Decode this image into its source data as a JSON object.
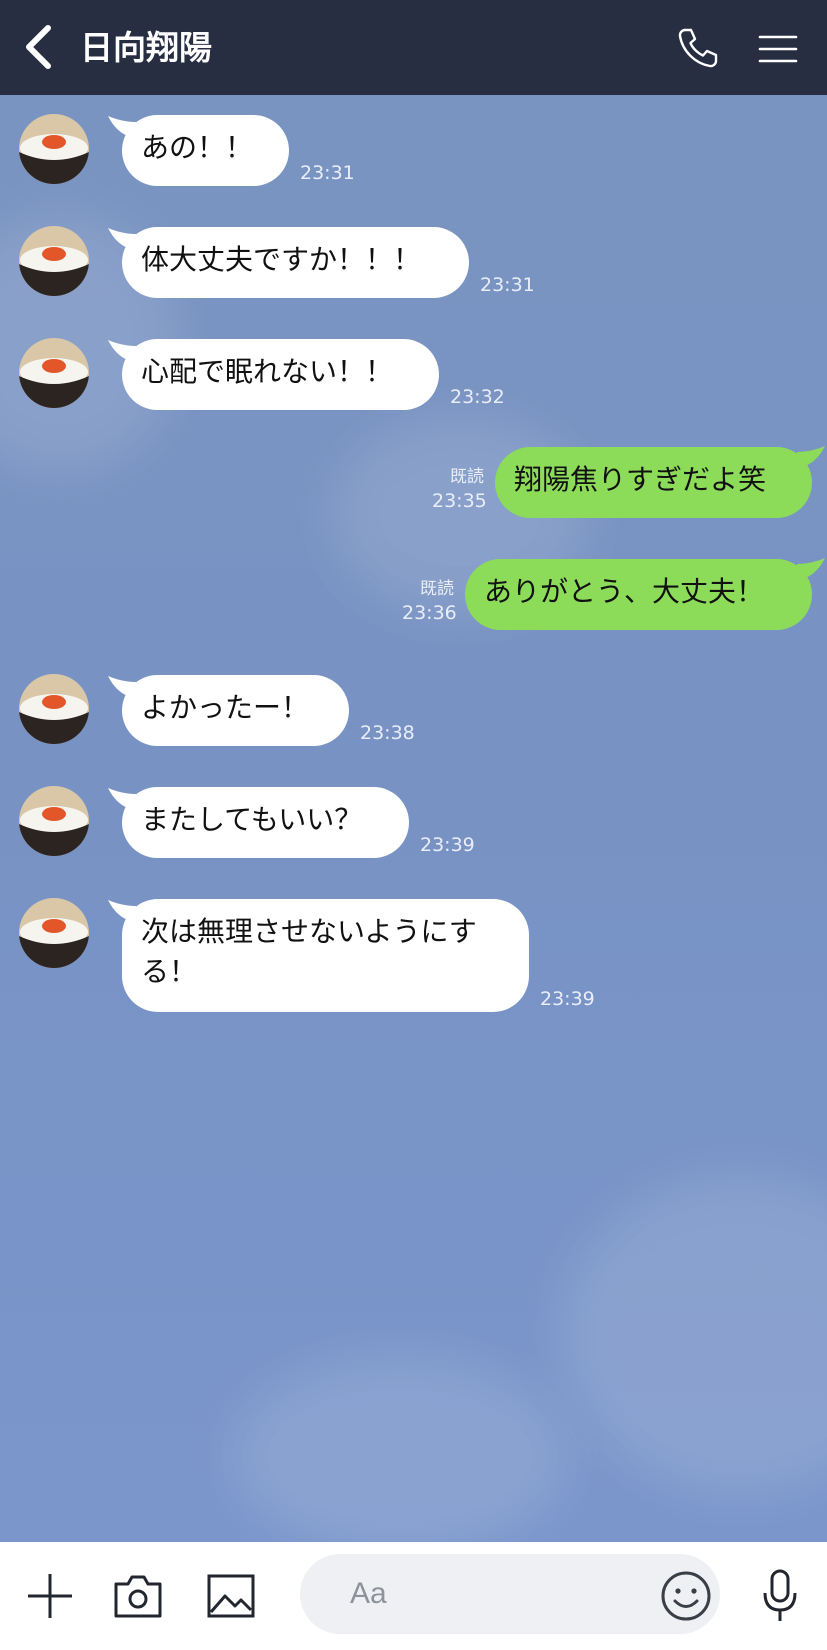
{
  "header": {
    "title": "日向翔陽",
    "back_icon": "chevron-left-icon",
    "call_icon": "phone-icon",
    "menu_icon": "hamburger-menu-icon",
    "background": "#272e42"
  },
  "messages": [
    {
      "side": "left",
      "text": "あの！！",
      "time": "23:31"
    },
    {
      "side": "left",
      "text": "体大丈夫ですか！！！",
      "time": "23:31"
    },
    {
      "side": "left",
      "text": "心配で眠れない！！",
      "time": "23:32"
    },
    {
      "side": "right",
      "text": "翔陽焦りすぎだよ笑",
      "time": "23:35",
      "read": "既読"
    },
    {
      "side": "right",
      "text": "ありがとう、大丈夫！",
      "time": "23:36",
      "read": "既読"
    },
    {
      "side": "left",
      "text": "よかったー！",
      "time": "23:38"
    },
    {
      "side": "left",
      "text": "またしてもいい？",
      "time": "23:39"
    },
    {
      "side": "left",
      "text": "次は無理させないようにする！",
      "time": "23:39"
    }
  ],
  "input": {
    "placeholder": "Aa",
    "plus_icon": "plus-icon",
    "camera_icon": "camera-icon",
    "image_icon": "image-icon",
    "emoji_icon": "emoji-icon",
    "mic_icon": "microphone-icon"
  },
  "colors": {
    "chat_background": "#7a94c2",
    "my_bubble": "#8cdc5a",
    "their_bubble": "#ffffff",
    "header": "#272e42"
  }
}
